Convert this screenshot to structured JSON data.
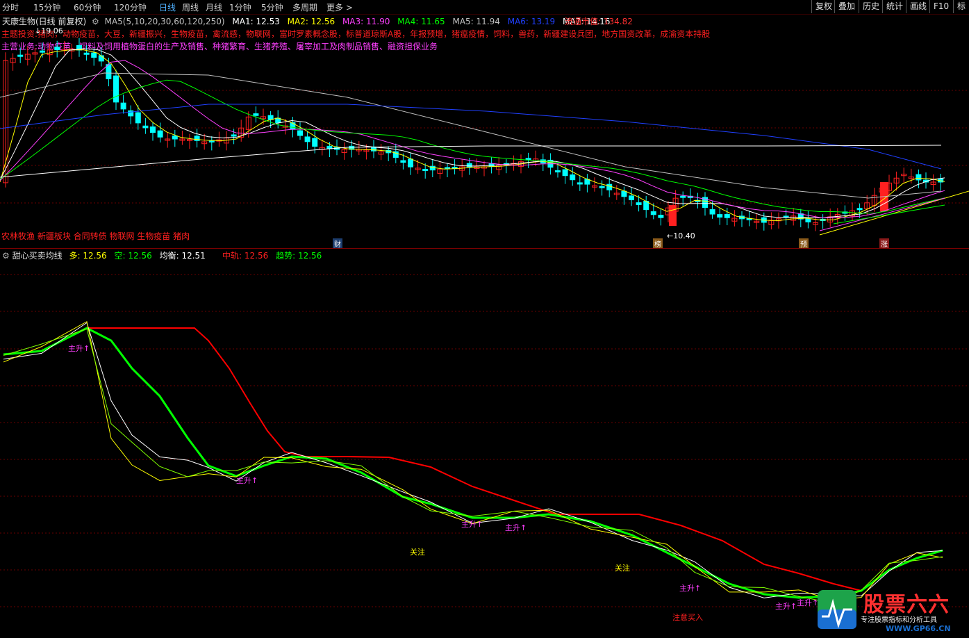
{
  "toolbar": {
    "periods": [
      "分时",
      "15分钟",
      "60分钟",
      "120分钟",
      "日线",
      "周线",
      "月线",
      "1分钟",
      "5分钟",
      "多周期",
      "更多"
    ],
    "active_period": "日线",
    "right_buttons": [
      "复权",
      "叠加",
      "历史",
      "统计",
      "画线",
      "F10",
      "标"
    ]
  },
  "main_chart": {
    "title": "天康生物(日线 前复权)",
    "ma_param": "MA5(5,10,20,30,60,120,250)",
    "ma": [
      {
        "label": "MA1:",
        "value": "12.53",
        "color": "#ffffff"
      },
      {
        "label": "MA2:",
        "value": "12.56",
        "color": "#ffff00"
      },
      {
        "label": "MA3:",
        "value": "11.90",
        "color": "#ff40ff"
      },
      {
        "label": "MA4:",
        "value": "11.65",
        "color": "#00ff00"
      },
      {
        "label": "MA5:",
        "value": "11.94",
        "color": "#c0c0c0"
      },
      {
        "label": "MA6:",
        "value": "13.19",
        "color": "#2040ff"
      },
      {
        "label": "MA7:",
        "value": "14.16",
        "color": "#ffffff"
      }
    ],
    "market_cap_label": "流通市值:",
    "market_cap_value": "134.82",
    "theme_label": "主题投资:",
    "theme_text": "猪肉，动物疫苗，大豆，新疆振兴，生物疫苗，禽流感，物联网，富时罗素概念股，标普道琼斯A股，年报预增，猪瘟疫情，饲料，兽药，新疆建设兵团，地方国资改革，成渝资本持股",
    "business_label": "主营业务:",
    "business_text": "动物疫苗、饲料及饲用植物蛋白的生产及销售、种猪繁育、生猪养殖、屠宰加工及肉制品销售、融资担保业务",
    "high_price_label": "19.06",
    "low_price_label": "10.40",
    "sectors": "农林牧渔 新疆板块 合同转债 物联网 生物疫苗 猪肉",
    "badges": [
      "财",
      "榜",
      "预",
      "涨"
    ]
  },
  "indicator": {
    "name": "甜心买卖均线",
    "items": [
      {
        "label": "多:",
        "value": "12.56",
        "color": "#ffff00"
      },
      {
        "label": "空:",
        "value": "12.56",
        "color": "#00ff00"
      },
      {
        "label": "均衡:",
        "value": "12.51",
        "color": "#ffffff"
      },
      {
        "label": "中轨:",
        "value": "12.56",
        "color": "#ff2020"
      },
      {
        "label": "趋势:",
        "value": "12.56",
        "color": "#00ff00"
      }
    ],
    "signals": {
      "up": "主升↑",
      "watch": "关注",
      "buy": "注意买入"
    }
  },
  "watermark": {
    "title": "股票六六",
    "subtitle": "专注股票指标和分析工具",
    "url": "WWW.GP66.CN"
  },
  "colors": {
    "rise": "#ff2020",
    "fall": "#00ffff",
    "ma1": "#ffffff",
    "ma2": "#ffff00",
    "ma3": "#ff40ff",
    "ma4": "#00ff00",
    "ma6": "#2040ff",
    "mid": "#ff0000",
    "trend": "#00ff00",
    "label": "#ff40ff",
    "grid": "#6a0000"
  }
}
